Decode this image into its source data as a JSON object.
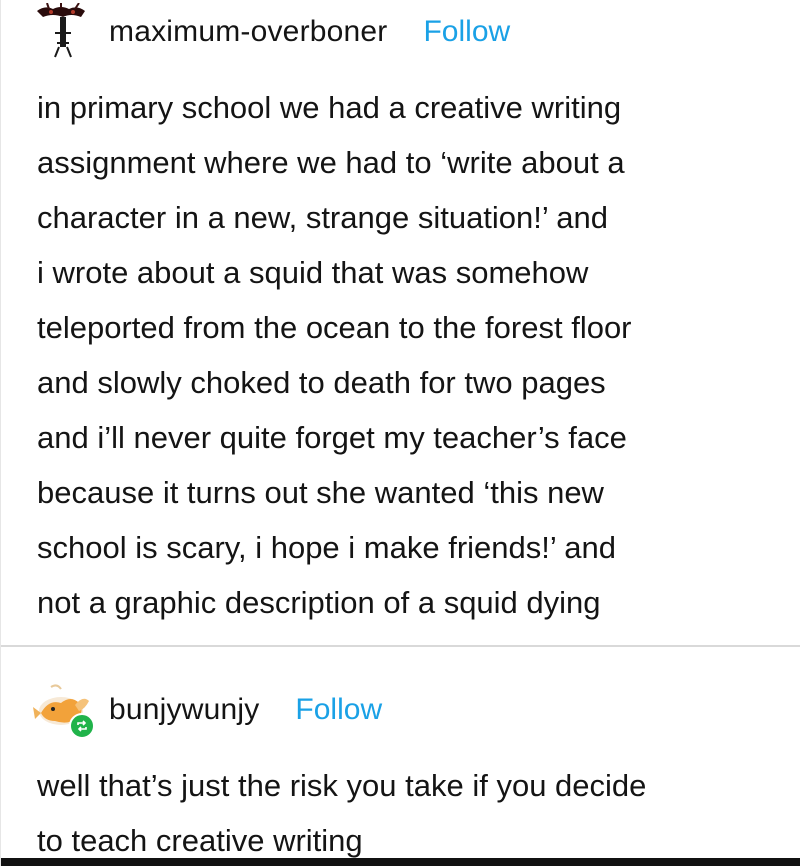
{
  "posts": [
    {
      "username": "maximum-overboner",
      "follow_label": "Follow",
      "text": "in primary school we had a creative writing\nassignment where we had to ‘write about a\ncharacter in a new, strange situation!’ and\ni wrote about a squid that was somehow\nteleported from the ocean to the forest floor\nand slowly choked to death for two pages\nand i’ll never quite forget my teacher’s face\nbecause it turns out she wanted ‘this new\nschool is scary, i hope i make friends!’ and\nnot a graphic description of a squid dying"
    },
    {
      "username": "bunjywunjy",
      "follow_label": "Follow",
      "text": "well that’s just the risk you take if you decide\nto teach creative writing"
    }
  ],
  "colors": {
    "follow": "#1aa1e6",
    "text": "#141414",
    "reblog_badge": "#20b34a"
  },
  "icons": {
    "post_1_avatar": "dark-figure-avatar-icon",
    "post_2_avatar": "goldfish-avatar-icon",
    "post_2_badge": "reblog-icon"
  }
}
